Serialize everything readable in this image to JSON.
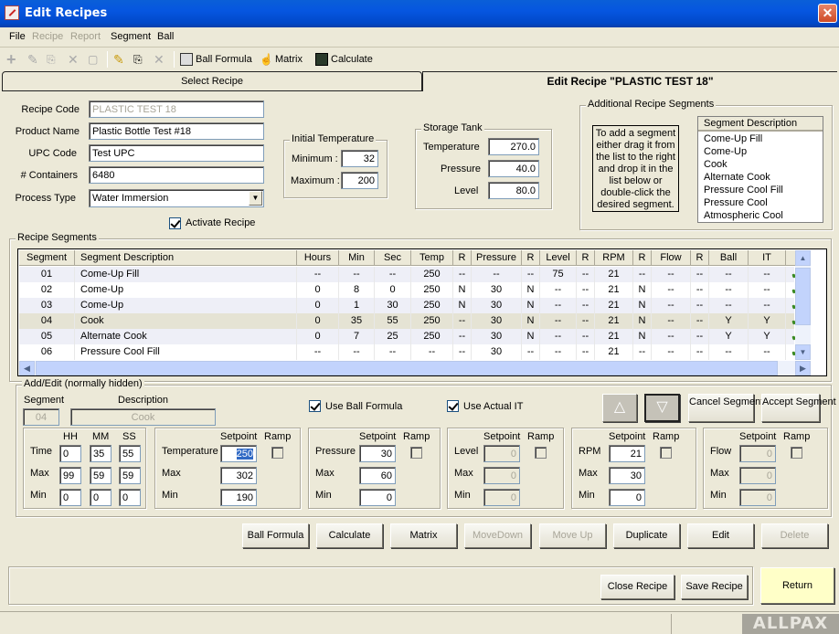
{
  "window": {
    "title": "Edit Recipes",
    "icon": "app-icon",
    "close": "✕"
  },
  "menu": [
    {
      "label": "File",
      "key": "F",
      "enabled": true
    },
    {
      "label": "Recipe",
      "enabled": false
    },
    {
      "label": "Report",
      "enabled": false
    },
    {
      "label": "Segment",
      "key": "S",
      "enabled": true
    },
    {
      "label": "Ball",
      "key": "B",
      "enabled": true
    }
  ],
  "toolbar": {
    "ball_formula": "Ball Formula",
    "matrix": "Matrix",
    "calculate": "Calculate"
  },
  "tabs": {
    "select": "Select Recipe",
    "edit": "Edit Recipe \"PLASTIC TEST 18\""
  },
  "recipe": {
    "code_label": "Recipe Code",
    "code": "PLASTIC TEST 18",
    "product_label": "Product Name",
    "product": "Plastic Bottle Test #18",
    "upc_label": "UPC Code",
    "upc": "Test UPC",
    "containers_label": "# Containers",
    "containers": "6480",
    "process_label": "Process Type",
    "process": "Water Immersion",
    "activate_label": "Activate Recipe",
    "activate": true
  },
  "initial_temp": {
    "title": "Initial Temperature",
    "min_label": "Minimum :",
    "min": "32",
    "max_label": "Maximum :",
    "max": "200"
  },
  "storage": {
    "title": "Storage Tank",
    "temp_label": "Temperature",
    "temp": "270.0",
    "pressure_label": "Pressure",
    "pressure": "40.0",
    "level_label": "Level",
    "level": "80.0"
  },
  "additional": {
    "title": "Additional Recipe Segments",
    "hint": "To add a segment either drag it from the list to the right and drop it in the list below or double-click the desired segment.",
    "header": "Segment Description",
    "items": [
      "Come-Up Fill",
      "Come-Up",
      "Cook",
      "Alternate Cook",
      "Pressure Cool Fill",
      "Pressure Cool",
      "Atmospheric Cool"
    ]
  },
  "segments": {
    "title": "Recipe Segments",
    "columns": [
      "Segment",
      "Segment Description",
      "Hours",
      "Min",
      "Sec",
      "Temp",
      "R",
      "Pressure",
      "R",
      "Level",
      "R",
      "RPM",
      "R",
      "Flow",
      "R",
      "Ball",
      "IT",
      ""
    ],
    "rows": [
      [
        "01",
        "Come-Up Fill",
        "--",
        "--",
        "--",
        "250",
        "--",
        "--",
        "--",
        "75",
        "--",
        "21",
        "--",
        "--",
        "--",
        "--",
        "--",
        "✔"
      ],
      [
        "02",
        "Come-Up",
        "0",
        "8",
        "0",
        "250",
        "N",
        "30",
        "N",
        "--",
        "--",
        "21",
        "N",
        "--",
        "--",
        "--",
        "--",
        "✔"
      ],
      [
        "03",
        "Come-Up",
        "0",
        "1",
        "30",
        "250",
        "N",
        "30",
        "N",
        "--",
        "--",
        "21",
        "N",
        "--",
        "--",
        "--",
        "--",
        "✔"
      ],
      [
        "04",
        "Cook",
        "0",
        "35",
        "55",
        "250",
        "--",
        "30",
        "N",
        "--",
        "--",
        "21",
        "N",
        "--",
        "--",
        "Y",
        "Y",
        "✔"
      ],
      [
        "05",
        "Alternate Cook",
        "0",
        "7",
        "25",
        "250",
        "--",
        "30",
        "N",
        "--",
        "--",
        "21",
        "N",
        "--",
        "--",
        "Y",
        "Y",
        "✔"
      ],
      [
        "06",
        "Pressure Cool Fill",
        "--",
        "--",
        "--",
        "--",
        "--",
        "30",
        "--",
        "--",
        "--",
        "21",
        "--",
        "--",
        "--",
        "--",
        "--",
        "✔"
      ]
    ],
    "selected_row": 3
  },
  "addedit": {
    "title": "Add/Edit (normally hidden)",
    "segment_label": "Segment",
    "segment": "04",
    "desc_label": "Description",
    "desc": "Cook",
    "use_ball_label": "Use Ball Formula",
    "use_ball": true,
    "use_it_label": "Use Actual IT",
    "use_it": true,
    "cancel": "Cancel Segment",
    "accept": "Accept Segment",
    "time": {
      "hh": "HH",
      "mm": "MM",
      "ss": "SS",
      "time_label": "Time",
      "max_label": "Max",
      "min_label": "Min",
      "time": [
        "0",
        "35",
        "55"
      ],
      "max": [
        "99",
        "59",
        "59"
      ],
      "min": [
        "0",
        "0",
        "0"
      ]
    },
    "setpoint_label": "Setpoint",
    "ramp_label": "Ramp",
    "max_label": "Max",
    "min_label": "Min",
    "temperature": {
      "label": "Temperature",
      "sp": "250",
      "max": "302",
      "min": "190"
    },
    "pressure": {
      "label": "Pressure",
      "sp": "30",
      "max": "60",
      "min": "0"
    },
    "level": {
      "label": "Level",
      "sp": "0",
      "max": "0",
      "min": "0"
    },
    "rpm": {
      "label": "RPM",
      "sp": "21",
      "max": "30",
      "min": "0"
    },
    "flow": {
      "label": "Flow",
      "sp": "0",
      "max": "0",
      "min": "0"
    }
  },
  "actions": {
    "ball_formula": "Ball Formula",
    "calculate": "Calculate",
    "matrix": "Matrix",
    "move_down": "MoveDown",
    "move_up": "Move Up",
    "duplicate": "Duplicate",
    "edit": "Edit",
    "delete": "Delete"
  },
  "footer": {
    "close": "Close Recipe",
    "save": "Save Recipe",
    "return": "Return"
  },
  "logo": "ALLPAX"
}
